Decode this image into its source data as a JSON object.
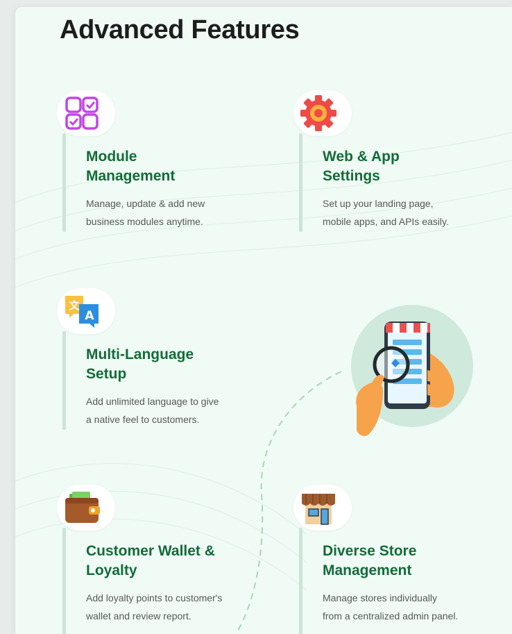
{
  "heading": "Advanced Features",
  "features": [
    {
      "title_line1": "Module",
      "title_line2": "Management",
      "desc_line1": "Manage, update & add new",
      "desc_line2": "business modules anytime.",
      "icon": "module-grid-icon"
    },
    {
      "title_line1": "Web & App",
      "title_line2": "Settings",
      "desc_line1": "Set up your landing page,",
      "desc_line2": "mobile apps, and APIs easily.",
      "icon": "gear-icon"
    },
    {
      "title_line1": "Multi-Language",
      "title_line2": "Setup",
      "desc_line1": "Add unlimited language to give",
      "desc_line2": "a native feel  to customers.",
      "icon": "translate-icon"
    },
    {
      "title_line1": "Customer Wallet &",
      "title_line2": "Loyalty",
      "desc_line1": "Add loyalty points to customer's",
      "desc_line2": "wallet and review report.",
      "icon": "wallet-icon"
    },
    {
      "title_line1": "Diverse Store",
      "title_line2": "Management",
      "desc_line1": "Manage stores individually",
      "desc_line2": "from a centralized admin panel.",
      "icon": "store-icon"
    }
  ],
  "illustration": "phone-search-illustration",
  "colors": {
    "background": "#effbf4",
    "title": "#146b3a",
    "heading": "#1d1d1d",
    "body_text": "#555a57",
    "accent_bar": "#cfe3d8"
  }
}
